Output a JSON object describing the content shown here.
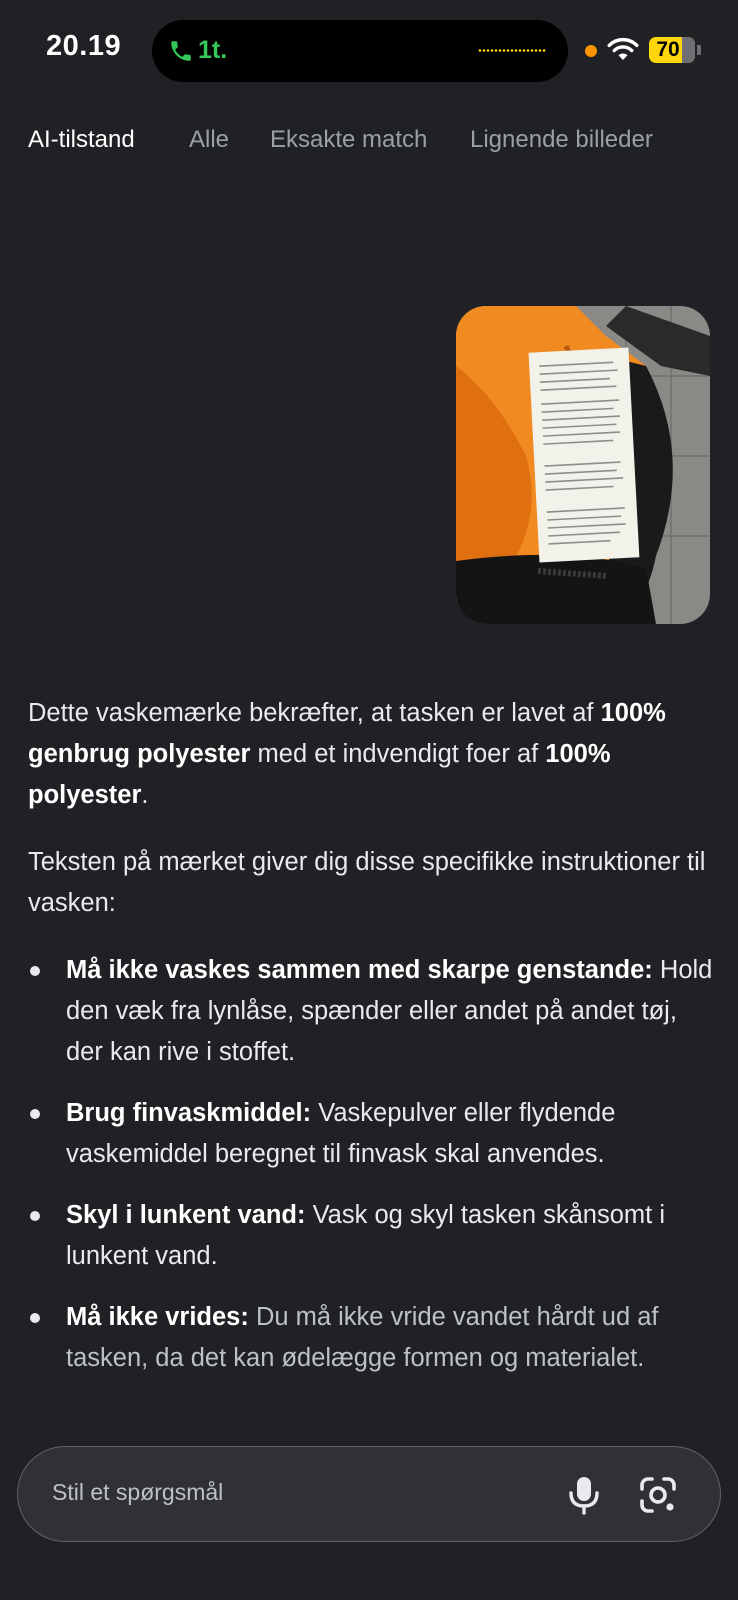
{
  "status_bar": {
    "time": "20.19",
    "call_label": "1t.",
    "battery_level": "70",
    "battery_percent": 70,
    "icons": [
      "phone-icon",
      "privacy-dot",
      "wifi-icon",
      "battery-icon"
    ]
  },
  "tabs": [
    {
      "label": "AI-tilstand",
      "active": true
    },
    {
      "label": "Alle",
      "active": false
    },
    {
      "label": "Eksakte match",
      "active": false
    },
    {
      "label": "Lignende billeder",
      "active": false
    }
  ],
  "answer": {
    "intro": {
      "t1": "Dette vaskemærke bekræfter, at tasken er lavet af ",
      "b1": "100% genbrug polyester",
      "t2": " med et indvendigt foer af ",
      "b2": "100% polyester",
      "t3": "."
    },
    "lead": "Teksten på mærket giver dig disse specifikke instruktioner til vasken:",
    "bullets": [
      {
        "title": "Må ikke vaskes sammen med skarpe genstande:",
        "text": " Hold den væk fra lynlåse, spænder eller andet på andet tøj, der kan rive i stoffet."
      },
      {
        "title": "Brug finvaskmiddel:",
        "text": " Vaskepulver eller flydende vaskemiddel beregnet til finvask skal anvendes."
      },
      {
        "title": "Skyl i lunkent vand:",
        "text": " Vask og skyl tasken skånsomt i lunkent vand."
      },
      {
        "title": "Må ikke vrides:",
        "text": " Du må ikke vride vandet hårdt ud af tasken, da det kan ødelægge formen og materialet."
      }
    ]
  },
  "composer": {
    "placeholder": "Stil et spørgsmål",
    "icons": [
      "mic-icon",
      "lens-icon"
    ]
  },
  "colors": {
    "background": "#202124",
    "text": "#e8eaed",
    "muted": "#9aa0a6",
    "call_green": "#34c759",
    "battery_yellow": "#ffd60a",
    "bag_orange": "#f28a22"
  }
}
